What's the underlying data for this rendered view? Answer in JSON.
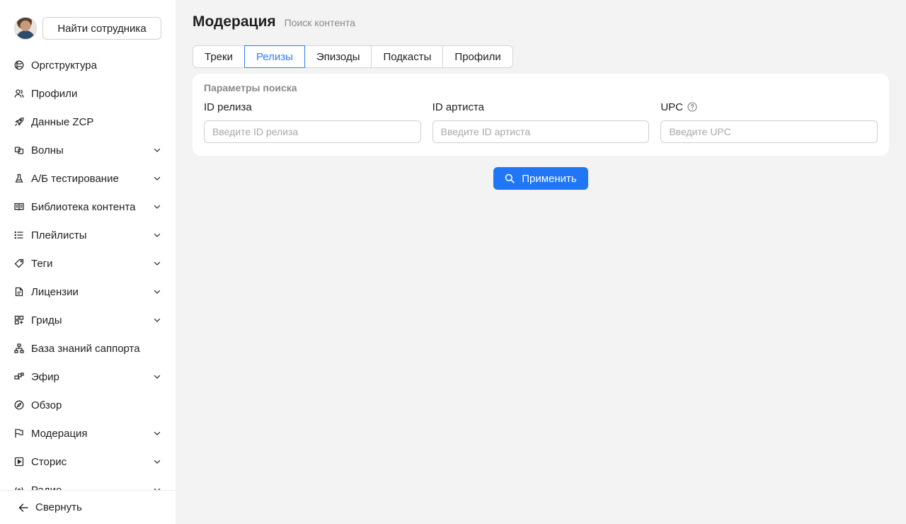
{
  "sidebar": {
    "find_employee_label": "Найти сотрудника",
    "items": [
      {
        "label": "Оргструктура",
        "icon": "orgstructure-icon",
        "has_chevron": false
      },
      {
        "label": "Профили",
        "icon": "profiles-icon",
        "has_chevron": false
      },
      {
        "label": "Данные ZCP",
        "icon": "rocket-icon",
        "has_chevron": false
      },
      {
        "label": "Волны",
        "icon": "waves-icon",
        "has_chevron": true
      },
      {
        "label": "А/Б тестирование",
        "icon": "flask-icon",
        "has_chevron": true
      },
      {
        "label": "Библиотека контента",
        "icon": "book-icon",
        "has_chevron": true
      },
      {
        "label": "Плейлисты",
        "icon": "list-icon",
        "has_chevron": true
      },
      {
        "label": "Теги",
        "icon": "tag-icon",
        "has_chevron": true
      },
      {
        "label": "Лицензии",
        "icon": "document-icon",
        "has_chevron": true
      },
      {
        "label": "Гриды",
        "icon": "grid-icon",
        "has_chevron": true
      },
      {
        "label": "База знаний саппорта",
        "icon": "hierarchy-icon",
        "has_chevron": false
      },
      {
        "label": "Эфир",
        "icon": "broadcast-icon",
        "has_chevron": true
      },
      {
        "label": "Обзор",
        "icon": "compass-icon",
        "has_chevron": false
      },
      {
        "label": "Модерация",
        "icon": "flag-icon",
        "has_chevron": true
      },
      {
        "label": "Сторис",
        "icon": "play-square-icon",
        "has_chevron": true
      },
      {
        "label": "Радио",
        "icon": "radio-icon",
        "has_chevron": true
      }
    ],
    "collapse_label": "Свернуть"
  },
  "header": {
    "title": "Модерация",
    "subtitle": "Поиск контента"
  },
  "tabs": [
    {
      "label": "Треки",
      "active": false
    },
    {
      "label": "Релизы",
      "active": true
    },
    {
      "label": "Эпизоды",
      "active": false
    },
    {
      "label": "Подкасты",
      "active": false
    },
    {
      "label": "Профили",
      "active": false
    }
  ],
  "search": {
    "title": "Параметры поиска",
    "fields": [
      {
        "label": "ID релиза",
        "placeholder": "Введите ID релиза",
        "value": "",
        "has_help": false
      },
      {
        "label": "ID артиста",
        "placeholder": "Введите ID артиста",
        "value": "",
        "has_help": false
      },
      {
        "label": "UPC",
        "placeholder": "Введите UPC",
        "value": "",
        "has_help": true
      }
    ],
    "apply_label": "Применить"
  },
  "colors": {
    "accent": "#2176f5",
    "active_tab": "#2f7cf6",
    "background": "#f3f3f3"
  }
}
